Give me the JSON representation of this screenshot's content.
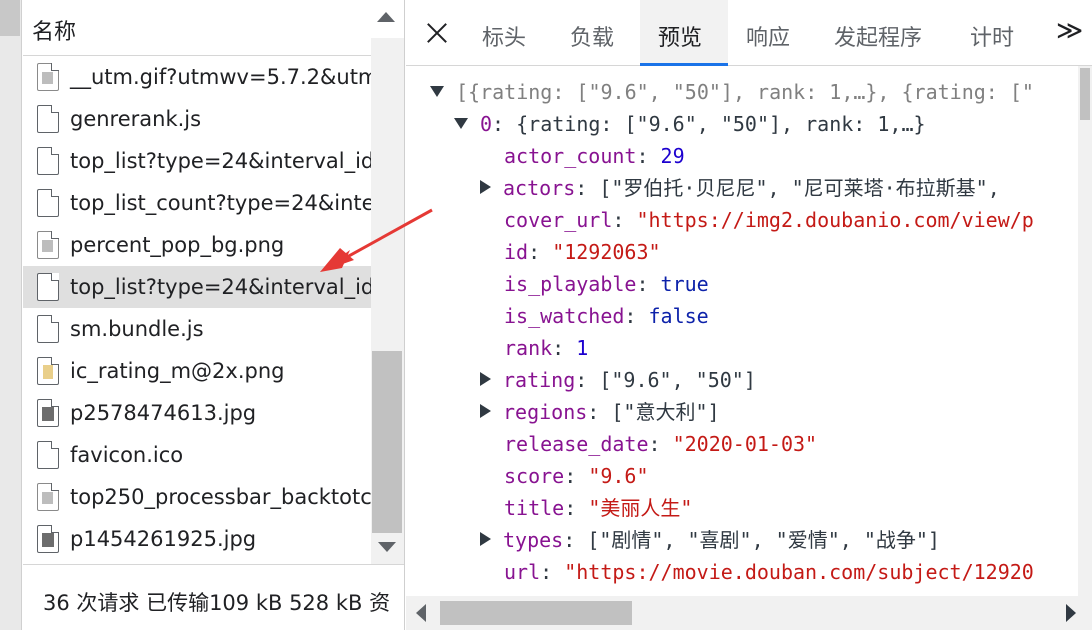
{
  "file_list": {
    "header": "名称",
    "items": [
      {
        "name": "__utm.gif?utmwv=5.7.2&utm",
        "icon": "image-file-icon"
      },
      {
        "name": "genrerank.js",
        "icon": "file-icon"
      },
      {
        "name": "top_list?type=24&interval_id",
        "icon": "file-icon"
      },
      {
        "name": "top_list_count?type=24&inte",
        "icon": "file-icon"
      },
      {
        "name": "percent_pop_bg.png",
        "icon": "image-file-icon"
      },
      {
        "name": "top_list?type=24&interval_id",
        "icon": "file-icon",
        "selected": true
      },
      {
        "name": "sm.bundle.js",
        "icon": "file-icon"
      },
      {
        "name": "ic_rating_m@2x.png",
        "icon": "png-file-icon"
      },
      {
        "name": "p2578474613.jpg",
        "icon": "jpg-file-icon"
      },
      {
        "name": "favicon.ico",
        "icon": "file-icon"
      },
      {
        "name": "top250_processbar_backtotc",
        "icon": "image-file-icon"
      },
      {
        "name": "p1454261925.jpg",
        "icon": "jpg-file-icon"
      }
    ],
    "status": "36 次请求  已传输109 kB  528 kB 资"
  },
  "tabs": {
    "close_label": "close-icon",
    "items": [
      "标头",
      "负载",
      "预览",
      "响应",
      "发起程序",
      "计时"
    ],
    "active": "预览",
    "more": "≫"
  },
  "json_preview": {
    "root_summary": "[{rating: [\"9.6\", \"50\"], rank: 1,…}, {rating: [\"",
    "item0_key": "0",
    "item0_summary": "{rating: [\"9.6\", \"50\"], rank: 1,…}",
    "actor_count_key": "actor_count",
    "actor_count": "29",
    "actors_key": "actors",
    "actors": "[\"罗伯托·贝尼尼\", \"尼可莱塔·布拉斯基\",",
    "cover_url_key": "cover_url",
    "cover_url": "\"https://img2.doubanio.com/view/p",
    "id_key": "id",
    "id": "\"1292063\"",
    "is_playable_key": "is_playable",
    "is_playable": "true",
    "is_watched_key": "is_watched",
    "is_watched": "false",
    "rank_key": "rank",
    "rank": "1",
    "rating_key": "rating",
    "rating": "[\"9.6\", \"50\"]",
    "regions_key": "regions",
    "regions": "[\"意大利\"]",
    "release_date_key": "release_date",
    "release_date": "\"2020-01-03\"",
    "score_key": "score",
    "score": "\"9.6\"",
    "title_key": "title",
    "title": "\"美丽人生\"",
    "types_key": "types",
    "types": "[\"剧情\", \"喜剧\", \"爱情\", \"战争\"]",
    "url_key": "url",
    "url": "\"https://movie.douban.com/subject/12920"
  },
  "colors": {
    "key": "#881391",
    "string": "#c41a16",
    "number": "#1c00cf",
    "active_tab_underline": "#1a73e8",
    "annotation_arrow": "#e53935"
  }
}
